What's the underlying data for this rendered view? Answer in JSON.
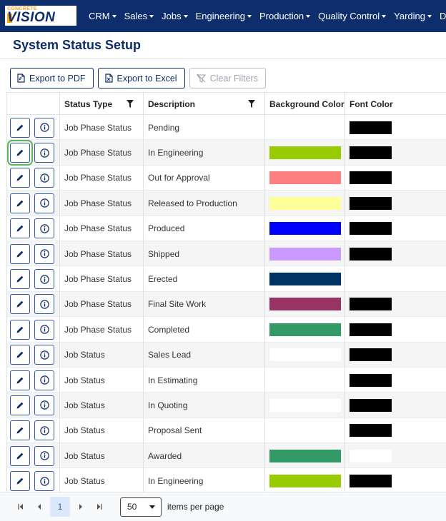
{
  "brand": {
    "small": "CONCRETE",
    "big": "VISION"
  },
  "nav": [
    {
      "label": "CRM"
    },
    {
      "label": "Sales"
    },
    {
      "label": "Jobs"
    },
    {
      "label": "Engineering"
    },
    {
      "label": "Production"
    },
    {
      "label": "Quality Control"
    },
    {
      "label": "Yarding"
    },
    {
      "label": "Dispatch"
    }
  ],
  "page_title": "System Status Setup",
  "toolbar": {
    "export_pdf": "Export to PDF",
    "export_excel": "Export to Excel",
    "clear_filters": "Clear Filters"
  },
  "columns": {
    "status_type": "Status Type",
    "description": "Description",
    "background_color": "Background Color",
    "font_color": "Font Color"
  },
  "rows": [
    {
      "status_type": "Job Phase Status",
      "description": "Pending",
      "bg": null,
      "font": "#000000"
    },
    {
      "status_type": "Job Phase Status",
      "description": "In Engineering",
      "bg": "#99cc00",
      "font": "#000000"
    },
    {
      "status_type": "Job Phase Status",
      "description": "Out for Approval",
      "bg": "#ff8080",
      "font": "#000000"
    },
    {
      "status_type": "Job Phase Status",
      "description": "Released to Production",
      "bg": "#ffff99",
      "font": "#000000"
    },
    {
      "status_type": "Job Phase Status",
      "description": "Produced",
      "bg": "#0000ff",
      "font": "#000000"
    },
    {
      "status_type": "Job Phase Status",
      "description": "Shipped",
      "bg": "#cc99ff",
      "font": "#000000"
    },
    {
      "status_type": "Job Phase Status",
      "description": "Erected",
      "bg": "#003366",
      "font": null
    },
    {
      "status_type": "Job Phase Status",
      "description": "Final Site Work",
      "bg": "#993366",
      "font": "#000000"
    },
    {
      "status_type": "Job Phase Status",
      "description": "Completed",
      "bg": "#339966",
      "font": "#000000"
    },
    {
      "status_type": "Job Status",
      "description": "Sales Lead",
      "bg": "#ffffff",
      "font": "#000000"
    },
    {
      "status_type": "Job Status",
      "description": "In Estimating",
      "bg": null,
      "font": "#000000"
    },
    {
      "status_type": "Job Status",
      "description": "In Quoting",
      "bg": "#ffffff",
      "font": "#000000"
    },
    {
      "status_type": "Job Status",
      "description": "Proposal Sent",
      "bg": null,
      "font": "#000000"
    },
    {
      "status_type": "Job Status",
      "description": "Awarded",
      "bg": "#339966",
      "font": "#ffffff"
    },
    {
      "status_type": "Job Status",
      "description": "In Engineering",
      "bg": "#99cc00",
      "font": "#000000"
    }
  ],
  "focused_row": 1,
  "pager": {
    "current_page": "1",
    "page_size": "50",
    "items_per_page_label": "items per page"
  },
  "colors": {
    "nav_bg": "#0d2d6b",
    "accent": "#2f5aa8",
    "focus_outline": "#5cb85c"
  }
}
